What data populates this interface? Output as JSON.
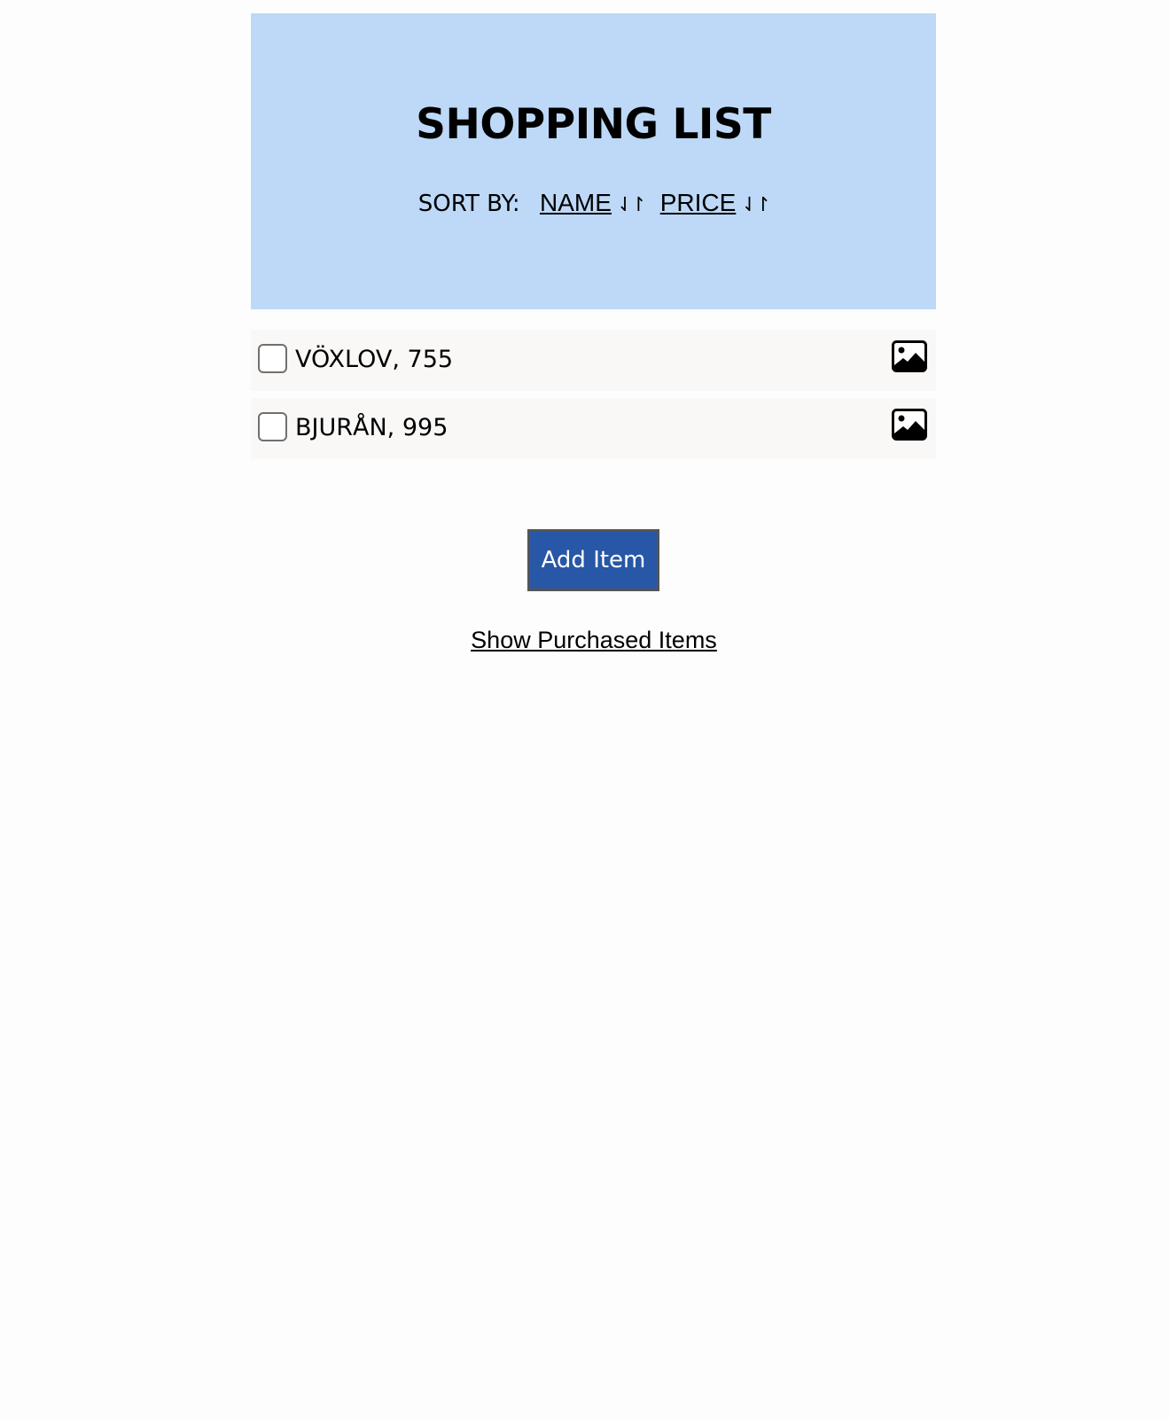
{
  "header": {
    "title": "SHOPPING LIST",
    "sort_label": "SORT BY:",
    "sort_name": "NAME",
    "sort_price": "PRICE",
    "sort_icon": "⇃↾",
    "background_color": "#bdd9f7"
  },
  "items": [
    {
      "label": "VÖXLOV, 755",
      "checked": false,
      "icon": "image-icon"
    },
    {
      "label": "BJURÅN, 995",
      "checked": false,
      "icon": "image-icon"
    }
  ],
  "actions": {
    "add_item": "Add Item",
    "add_item_color": "#2757a6",
    "show_purchased": "Show Purchased Items"
  }
}
